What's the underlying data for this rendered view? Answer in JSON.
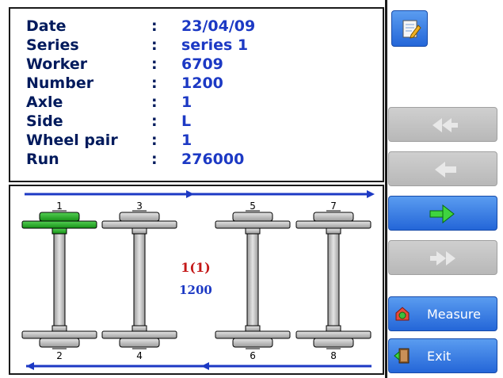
{
  "info": {
    "rows": [
      {
        "label": "Date",
        "sep": ":",
        "value": "23/04/09"
      },
      {
        "label": "Series",
        "sep": ":",
        "value": "series 1"
      },
      {
        "label": "Worker",
        "sep": ":",
        "value": "6709"
      },
      {
        "label": "Number",
        "sep": ":",
        "value": "1200"
      },
      {
        "label": "Axle",
        "sep": ":",
        "value": "1"
      },
      {
        "label": "Side",
        "sep": ":",
        "value": "L"
      },
      {
        "label": "Wheel pair",
        "sep": ":",
        "value": "1"
      },
      {
        "label": "Run",
        "sep": ":",
        "value": "276000"
      }
    ]
  },
  "diagram": {
    "axles": [
      {
        "top": "1",
        "bottom": "2",
        "selected": true
      },
      {
        "top": "3",
        "bottom": "4",
        "selected": false
      },
      {
        "top": "5",
        "bottom": "6",
        "selected": false
      },
      {
        "top": "7",
        "bottom": "8",
        "selected": false
      }
    ],
    "center_label": "1(1)",
    "center_number": "1200"
  },
  "sidebar": {
    "edit_icon": "notepad-pencil-icon",
    "measure_label": "Measure",
    "exit_label": "Exit"
  },
  "colors": {
    "accent_blue": "#1c39c4",
    "selected_wheel": "#22a322",
    "button_blue": "#2466d8",
    "disabled_gray": "#c4c4c4"
  }
}
